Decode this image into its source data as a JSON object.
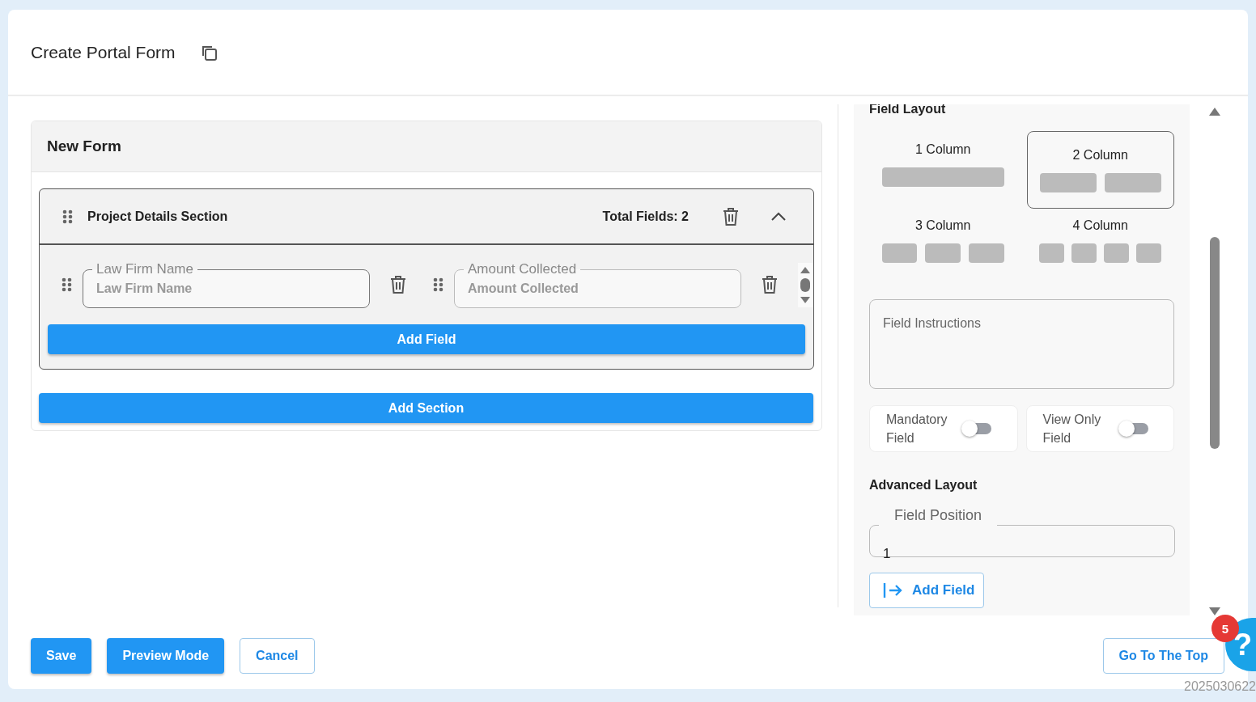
{
  "header": {
    "title": "Create Portal Form"
  },
  "form": {
    "title": "New Form",
    "sections": [
      {
        "title": "Project Details Section",
        "total_fields": "Total Fields: 2",
        "expanded": true,
        "fields": [
          {
            "label": "Law Firm Name",
            "placeholder": "Law Firm Name"
          },
          {
            "label": "Amount Collected",
            "placeholder": "Amount Collected"
          }
        ],
        "add_field": "Add Field"
      }
    ],
    "add_section": "Add Section"
  },
  "settings": {
    "field_layout": {
      "title": "Field Layout",
      "options": [
        {
          "label": "1 Column",
          "selected": false
        },
        {
          "label": "2 Column",
          "selected": true
        },
        {
          "label": "3 Column",
          "selected": false
        },
        {
          "label": "4 Column",
          "selected": false
        }
      ]
    },
    "instructions": {
      "placeholder": "Field Instructions"
    },
    "toggles": [
      {
        "label": "Mandatory Field",
        "on": false
      },
      {
        "label": "View Only Field",
        "on": false
      }
    ],
    "advanced": {
      "title": "Advanced Layout",
      "position": {
        "label": "Field Position",
        "value": "1"
      }
    },
    "add_field": "Add Field"
  },
  "footer": {
    "buttons": [
      {
        "label": "Save",
        "kind": "primary"
      },
      {
        "label": "Preview Mode",
        "kind": "primary"
      },
      {
        "label": "Cancel",
        "kind": "outline"
      }
    ],
    "go_top": "Go To The Top",
    "help": {
      "symbol": "?",
      "badge": "5"
    },
    "build": "2025030622"
  }
}
